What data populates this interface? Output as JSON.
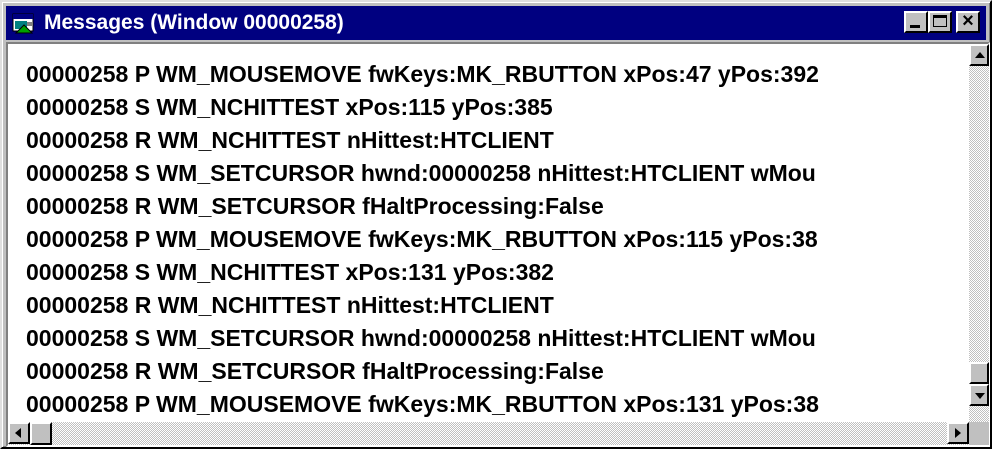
{
  "window": {
    "title": "Messages (Window 00000258)",
    "minimize_label": "",
    "maximize_label": "",
    "close_label": "×"
  },
  "messages": [
    "00000258 P WM_MOUSEMOVE fwKeys:MK_RBUTTON xPos:47 yPos:392",
    "00000258 S WM_NCHITTEST xPos:115 yPos:385",
    "00000258 R WM_NCHITTEST nHittest:HTCLIENT",
    "00000258 S WM_SETCURSOR hwnd:00000258 nHittest:HTCLIENT wMou",
    "00000258 R WM_SETCURSOR fHaltProcessing:False",
    "00000258 P WM_MOUSEMOVE fwKeys:MK_RBUTTON xPos:115 yPos:38",
    "00000258 S WM_NCHITTEST xPos:131 yPos:382",
    "00000258 R WM_NCHITTEST nHittest:HTCLIENT",
    "00000258 S WM_SETCURSOR hwnd:00000258 nHittest:HTCLIENT wMou",
    "00000258 R WM_SETCURSOR fHaltProcessing:False",
    "00000258 P WM_MOUSEMOVE fwKeys:MK_RBUTTON xPos:131 yPos:38"
  ],
  "colors": {
    "titlebar": "#000080",
    "face": "#c0c0c0",
    "list_background": "#ffffff"
  },
  "scrollbars": {
    "vertical_position": "bottom",
    "horizontal_position": "left"
  }
}
